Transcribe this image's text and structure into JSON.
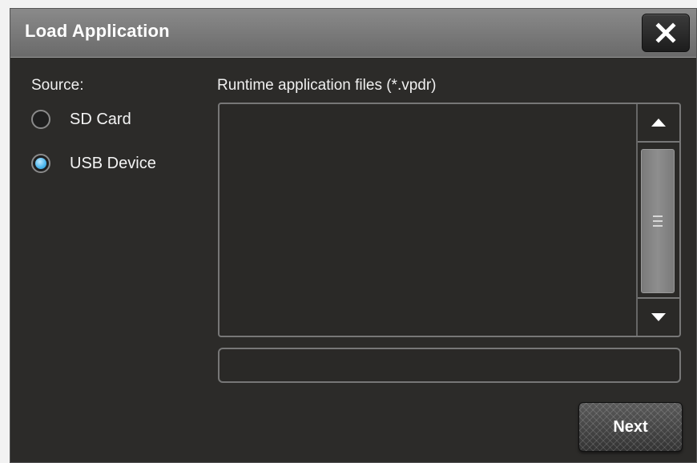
{
  "dialog": {
    "title": "Load Application"
  },
  "source": {
    "label": "Source:",
    "options": [
      {
        "label": "SD Card",
        "selected": false
      },
      {
        "label": "USB Device",
        "selected": true
      }
    ]
  },
  "files": {
    "label": "Runtime application files (*.vpdr)",
    "items": []
  },
  "filename": {
    "value": ""
  },
  "actions": {
    "next_label": "Next"
  },
  "colors": {
    "background": "#2c2b29",
    "titlebar": "#7a7a7a",
    "radio_selected": "#4ab5ec"
  },
  "icons": {
    "close": "close-icon",
    "scroll_up": "triangle-up-icon",
    "scroll_down": "triangle-down-icon",
    "thumb_grip": "grip-icon"
  }
}
